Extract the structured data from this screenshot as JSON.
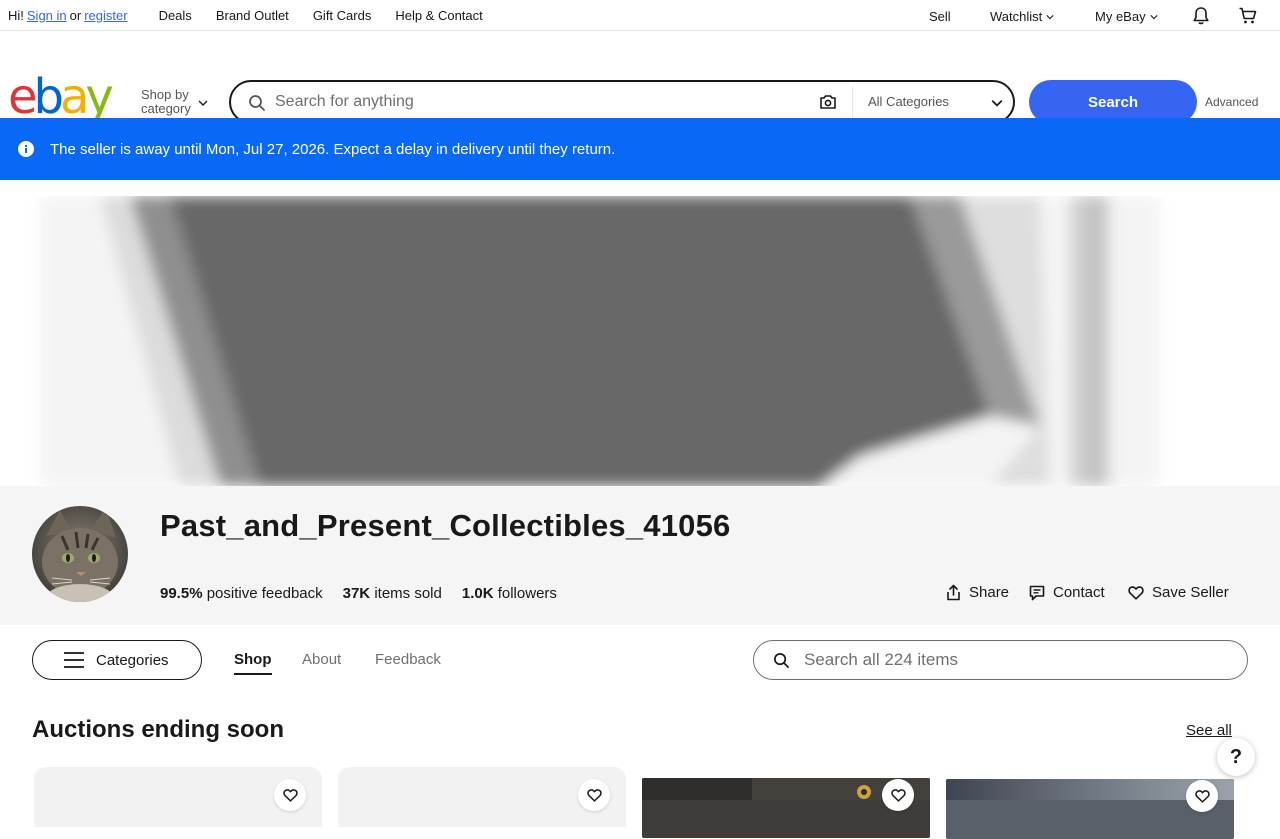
{
  "topnav": {
    "greeting_prefix": "Hi!",
    "sign_in": "Sign in",
    "or": "or",
    "register": "register",
    "links": [
      "Deals",
      "Brand Outlet",
      "Gift Cards",
      "Help & Contact"
    ],
    "sell": "Sell",
    "watchlist": "Watchlist",
    "my_ebay": "My eBay"
  },
  "header": {
    "shop_by_line1": "Shop by",
    "shop_by_line2": "category",
    "search_placeholder": "Search for anything",
    "category_select": "All Categories",
    "search_button": "Search",
    "advanced": "Advanced"
  },
  "banner": {
    "message": "The seller is away until Mon, Jul 27, 2026. Expect a delay in delivery until they return."
  },
  "store": {
    "name": "Past_and_Present_Collectibles_41056",
    "feedback_value": "99.5%",
    "feedback_label": "positive feedback",
    "sold_value": "37K",
    "sold_label": "items sold",
    "followers_value": "1.0K",
    "followers_label": "followers",
    "share": "Share",
    "contact": "Contact",
    "save_seller": "Save Seller"
  },
  "store_nav": {
    "categories": "Categories",
    "tabs": [
      "Shop",
      "About",
      "Feedback"
    ],
    "search_placeholder": "Search all 224 items"
  },
  "auctions": {
    "title": "Auctions ending soon",
    "see_all": "See all"
  },
  "help": "?",
  "colors": {
    "brand_blue": "#3665f3",
    "banner_blue": "#0968f6"
  }
}
